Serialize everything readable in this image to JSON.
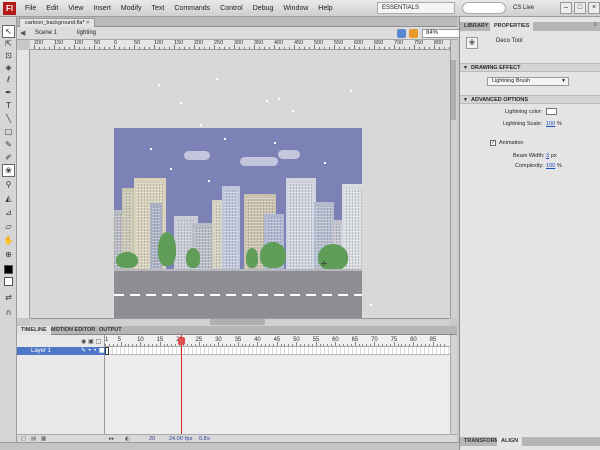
{
  "app": {
    "logo": "Fl",
    "workspace": "ESSENTIALS",
    "cs_live": "CS Live"
  },
  "menu": [
    "File",
    "Edit",
    "View",
    "Insert",
    "Modify",
    "Text",
    "Commands",
    "Control",
    "Debug",
    "Window",
    "Help"
  ],
  "window_controls": [
    "–",
    "□",
    "×"
  ],
  "document": {
    "tab": "cartoon_background.fla*",
    "tab_close": "×"
  },
  "edit_bar": {
    "scene": "Scene 1",
    "symbol": "lighting",
    "zoom": "84%"
  },
  "ruler_labels": [
    "200",
    "150",
    "100",
    "50",
    "0",
    "50",
    "100",
    "150",
    "200",
    "250",
    "300",
    "350",
    "400",
    "450",
    "500",
    "550",
    "600",
    "650",
    "700",
    "750",
    "800"
  ],
  "toolbox": [
    "arrow-icon",
    "subselect-icon",
    "free-transform-icon",
    "gradient-icon",
    "lasso-icon",
    "pen-icon",
    "text-icon",
    "line-icon",
    "rectangle-icon",
    "pencil-icon",
    "brush-icon",
    "deco-icon",
    "bone-icon",
    "paint-bucket-icon",
    "eyedropper-icon",
    "eraser-icon",
    "hand-icon",
    "zoom-icon"
  ],
  "timeline": {
    "tabs": [
      "TIMELINE",
      "MOTION EDITOR",
      "OUTPUT"
    ],
    "layer_name": "Layer 1",
    "frame_labels": [
      "1",
      "5",
      "10",
      "15",
      "20",
      "25",
      "30",
      "35",
      "40",
      "45",
      "50",
      "55",
      "60",
      "65",
      "70",
      "75",
      "80",
      "85"
    ],
    "current_frame": "20",
    "fps": "24.00",
    "fps_unit": "fps",
    "elapsed": "0.8",
    "elapsed_unit": "s"
  },
  "panel": {
    "tabs": [
      "LIBRARY",
      "PROPERTIES"
    ],
    "tool_name": "Deco Tool",
    "drawing_effect_header": "DRAWING EFFECT",
    "effect": "Lightning Brush",
    "advanced_header": "ADVANCED OPTIONS",
    "lightning_color_label": "Lightning color:",
    "lightning_color": "#ffffff",
    "lightning_scale_label": "Lightning Scale:",
    "lightning_scale_value": "100",
    "pct": "%",
    "animation_label": "Animation",
    "animation_checked": true,
    "beam_width_label": "Beam Width:",
    "beam_width_value": "3",
    "beam_width_unit": "px",
    "complexity_label": "Complexity:",
    "complexity_value": "100",
    "bottom_tabs": [
      "TRANSFORM",
      "ALIGN"
    ]
  },
  "colors": {
    "sky": "#7c82b6",
    "accent": "#4f78c6",
    "playhead": "#d82c2c",
    "link": "#1f4fc2"
  }
}
